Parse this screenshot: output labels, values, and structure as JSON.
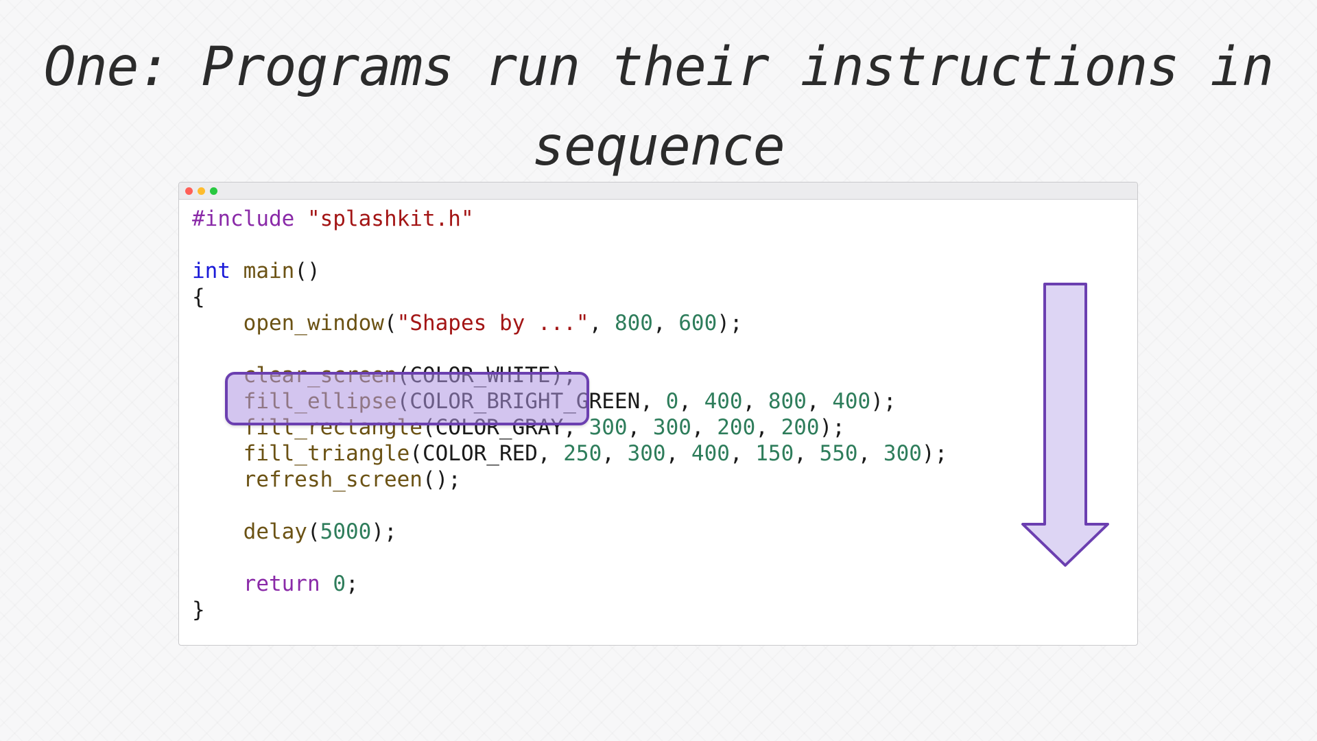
{
  "slide": {
    "title_line1": "One: Programs run their instructions in",
    "title_line2": "sequence"
  },
  "window": {
    "traffic_lights": [
      "close",
      "minimize",
      "zoom"
    ],
    "code_lines": [
      [
        {
          "t": "#include ",
          "k": "directive"
        },
        {
          "t": "\"splashkit.h\"",
          "k": "string"
        }
      ],
      [],
      [
        {
          "t": "int",
          "k": "keyword"
        },
        {
          "t": " ",
          "k": "plain"
        },
        {
          "t": "main",
          "k": "func"
        },
        {
          "t": "()",
          "k": "plain"
        }
      ],
      [
        {
          "t": "{",
          "k": "plain"
        }
      ],
      [
        {
          "t": "    ",
          "k": "plain"
        },
        {
          "t": "open_window",
          "k": "func"
        },
        {
          "t": "(",
          "k": "plain"
        },
        {
          "t": "\"Shapes by ...\"",
          "k": "string"
        },
        {
          "t": ", ",
          "k": "plain"
        },
        {
          "t": "800",
          "k": "number"
        },
        {
          "t": ", ",
          "k": "plain"
        },
        {
          "t": "600",
          "k": "number"
        },
        {
          "t": ");",
          "k": "plain"
        }
      ],
      [],
      [
        {
          "t": "    ",
          "k": "plain"
        },
        {
          "t": "clear_screen",
          "k": "func"
        },
        {
          "t": "(COLOR_WHITE);",
          "k": "plain"
        }
      ],
      [
        {
          "t": "    ",
          "k": "plain"
        },
        {
          "t": "fill_ellipse",
          "k": "func"
        },
        {
          "t": "(COLOR_BRIGHT_GREEN, ",
          "k": "plain"
        },
        {
          "t": "0",
          "k": "number"
        },
        {
          "t": ", ",
          "k": "plain"
        },
        {
          "t": "400",
          "k": "number"
        },
        {
          "t": ", ",
          "k": "plain"
        },
        {
          "t": "800",
          "k": "number"
        },
        {
          "t": ", ",
          "k": "plain"
        },
        {
          "t": "400",
          "k": "number"
        },
        {
          "t": ");",
          "k": "plain"
        }
      ],
      [
        {
          "t": "    ",
          "k": "plain"
        },
        {
          "t": "fill_rectangle",
          "k": "func"
        },
        {
          "t": "(COLOR_GRAY, ",
          "k": "plain"
        },
        {
          "t": "300",
          "k": "number"
        },
        {
          "t": ", ",
          "k": "plain"
        },
        {
          "t": "300",
          "k": "number"
        },
        {
          "t": ", ",
          "k": "plain"
        },
        {
          "t": "200",
          "k": "number"
        },
        {
          "t": ", ",
          "k": "plain"
        },
        {
          "t": "200",
          "k": "number"
        },
        {
          "t": ");",
          "k": "plain"
        }
      ],
      [
        {
          "t": "    ",
          "k": "plain"
        },
        {
          "t": "fill_triangle",
          "k": "func"
        },
        {
          "t": "(COLOR_RED, ",
          "k": "plain"
        },
        {
          "t": "250",
          "k": "number"
        },
        {
          "t": ", ",
          "k": "plain"
        },
        {
          "t": "300",
          "k": "number"
        },
        {
          "t": ", ",
          "k": "plain"
        },
        {
          "t": "400",
          "k": "number"
        },
        {
          "t": ", ",
          "k": "plain"
        },
        {
          "t": "150",
          "k": "number"
        },
        {
          "t": ", ",
          "k": "plain"
        },
        {
          "t": "550",
          "k": "number"
        },
        {
          "t": ", ",
          "k": "plain"
        },
        {
          "t": "300",
          "k": "number"
        },
        {
          "t": ");",
          "k": "plain"
        }
      ],
      [
        {
          "t": "    ",
          "k": "plain"
        },
        {
          "t": "refresh_screen",
          "k": "func"
        },
        {
          "t": "();",
          "k": "plain"
        }
      ],
      [],
      [
        {
          "t": "    ",
          "k": "plain"
        },
        {
          "t": "delay",
          "k": "func"
        },
        {
          "t": "(",
          "k": "plain"
        },
        {
          "t": "5000",
          "k": "number"
        },
        {
          "t": ");",
          "k": "plain"
        }
      ],
      [],
      [
        {
          "t": "    ",
          "k": "plain"
        },
        {
          "t": "return",
          "k": "return"
        },
        {
          "t": " ",
          "k": "plain"
        },
        {
          "t": "0",
          "k": "number"
        },
        {
          "t": ";",
          "k": "plain"
        }
      ],
      [
        {
          "t": "}",
          "k": "plain"
        }
      ]
    ],
    "highlighted_line": 7
  },
  "annotation": {
    "arrow_icon": "down-arrow-icon",
    "accent_color": "#6b3fb0",
    "highlight_fill": "#c9b8ec"
  }
}
